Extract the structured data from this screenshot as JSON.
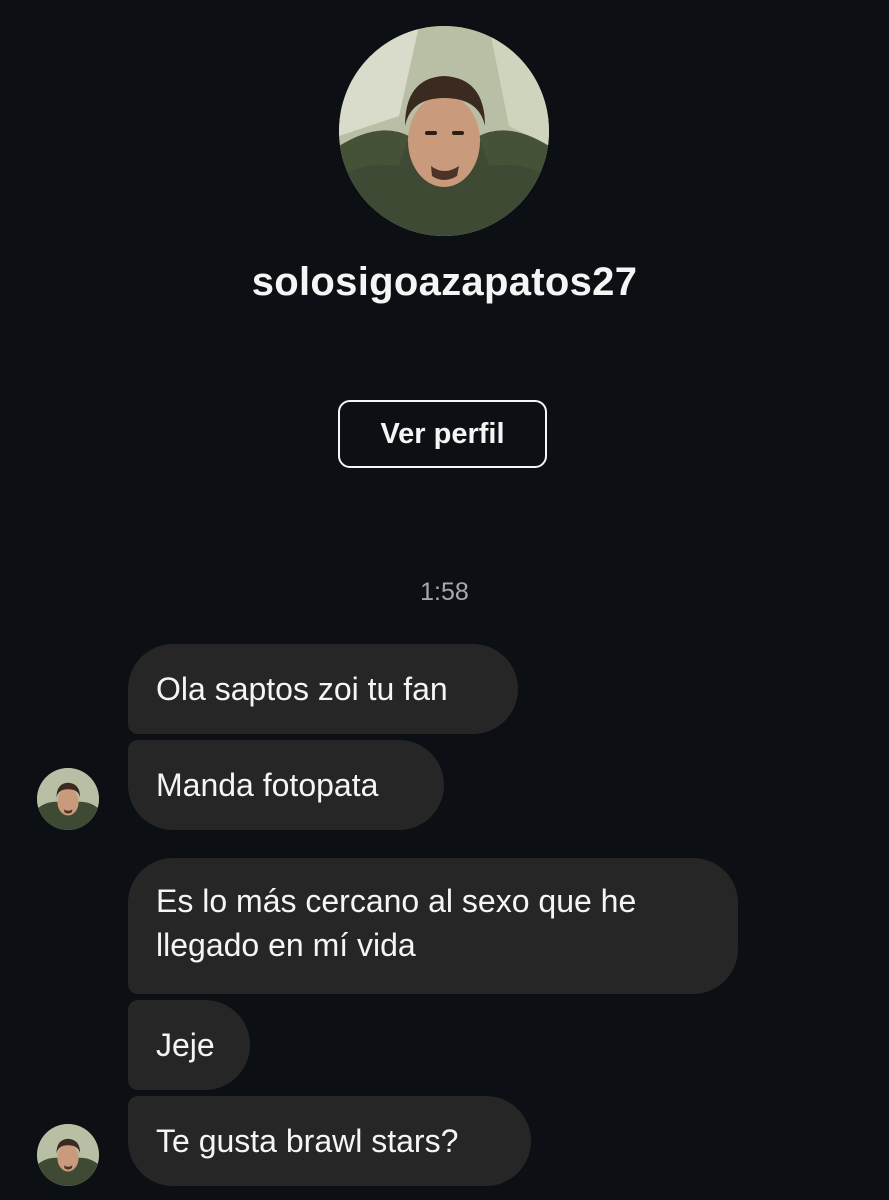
{
  "profile": {
    "username": "solosigoazapatos27",
    "view_profile_label": "Ver perfil"
  },
  "thread": {
    "timestamp": "1:58",
    "group1": [
      "Ola saptos zoi tu fan",
      "Manda fotopata"
    ],
    "group2": [
      "Es lo más cercano al sexo que he llegado en mí vida",
      "Jeje",
      "Te gusta brawl stars?"
    ]
  },
  "colors": {
    "background": "#0c1014",
    "bubble": "#262626",
    "text": "#f5f5f5",
    "timestamp": "#a8a8a8"
  }
}
